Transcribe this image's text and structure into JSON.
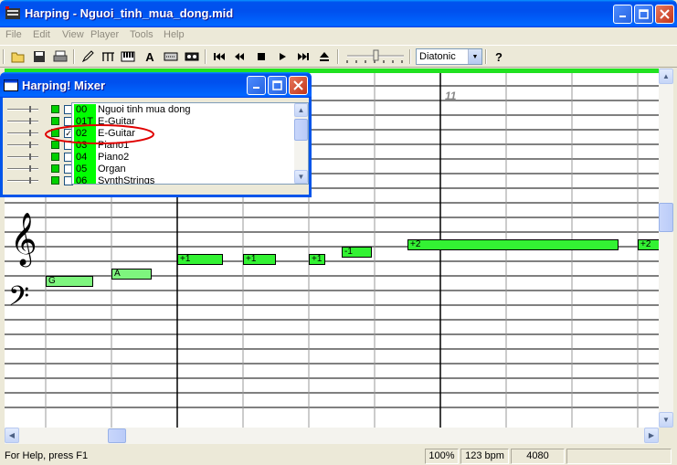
{
  "window": {
    "title": "Harping - Nguoi_tinh_mua_dong.mid"
  },
  "menu": [
    "File",
    "Edit",
    "View",
    "Player",
    "Tools",
    "Help"
  ],
  "toolbar": {
    "mode_select": "Diatonic",
    "text_tool": "A",
    "help_tool": "?"
  },
  "score": {
    "measure_number": "11",
    "notes": [
      {
        "label": "G",
        "style": "light"
      },
      {
        "label": "A",
        "style": "light"
      },
      {
        "label": "+1",
        "style": "normal"
      },
      {
        "label": "+1",
        "style": "normal"
      },
      {
        "label": "+1",
        "style": "normal"
      },
      {
        "label": "-1",
        "style": "normal"
      },
      {
        "label": "+2",
        "style": "normal"
      },
      {
        "label": "+2",
        "style": "normal"
      }
    ]
  },
  "mixer": {
    "title": "Harping! Mixer",
    "tracks": [
      {
        "num": "00",
        "name": "Nguoi tinh mua dong",
        "checked": false
      },
      {
        "num": "01T",
        "name": "E-Guitar",
        "checked": false
      },
      {
        "num": "02",
        "name": "E-Guitar",
        "checked": true
      },
      {
        "num": "03",
        "name": "Piano1",
        "checked": false
      },
      {
        "num": "04",
        "name": "Piano2",
        "checked": false
      },
      {
        "num": "05",
        "name": "Organ",
        "checked": false
      },
      {
        "num": "06",
        "name": "SynthStrings",
        "checked": false
      }
    ],
    "highlight_color": "#e00000"
  },
  "status": {
    "help_text": "For Help, press F1",
    "zoom": "100%",
    "tempo": "123 bpm",
    "position": "4080"
  },
  "colors": {
    "note_green": "#33f233",
    "note_light": "#7ef57e",
    "titlebar_blue": "#0053ee"
  }
}
